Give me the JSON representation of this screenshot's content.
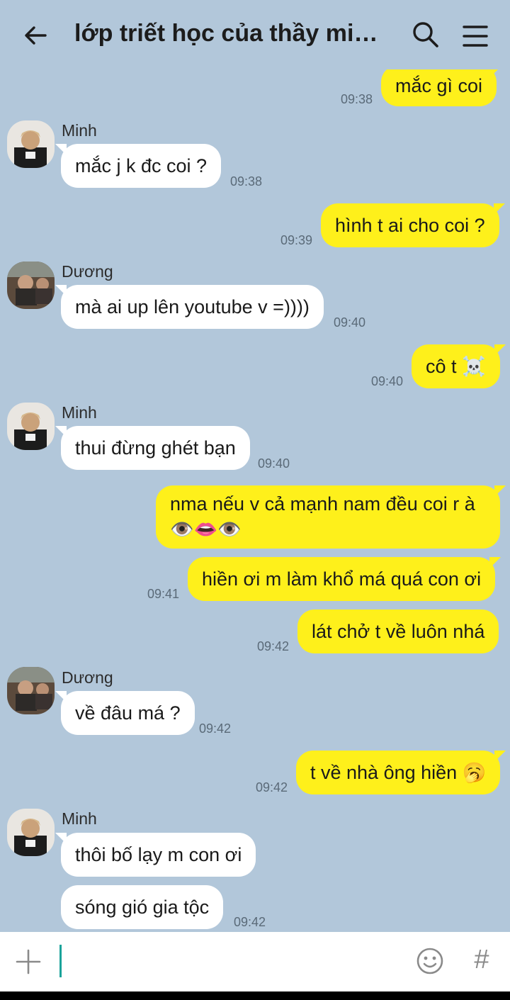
{
  "header": {
    "title": "lớp triết học của thầy min...",
    "icons": [
      "back-arrow-icon",
      "search-icon",
      "menu-icon"
    ]
  },
  "messages": [
    {
      "from": "me",
      "text": "mắc gì coi",
      "time": "09:38"
    },
    {
      "from": "other",
      "sender": "Minh",
      "text": "mắc j k đc coi ?",
      "time": "09:38"
    },
    {
      "from": "me",
      "text": "hình t ai cho coi ?",
      "time": "09:39"
    },
    {
      "from": "other",
      "sender": "Dương",
      "text": "mà ai up lên youtube v =))))",
      "time": "09:40"
    },
    {
      "from": "me",
      "text": "cô t ☠️",
      "time": "09:40"
    },
    {
      "from": "other",
      "sender": "Minh",
      "text": "thui đừng ghét bạn",
      "time": "09:40"
    },
    {
      "from": "me",
      "line1": "nma nếu v cả mạnh nam đều coi r à",
      "line2": "👁️👄👁️"
    },
    {
      "from": "me",
      "text": "hiền ơi m làm khổ má quá con ơi",
      "time": "09:41"
    },
    {
      "from": "me",
      "text": "lát chở t về luôn nhá",
      "time": "09:42"
    },
    {
      "from": "other",
      "sender": "Dương",
      "text": "về đâu má ?",
      "time": "09:42"
    },
    {
      "from": "me",
      "text": "t về nhà ông hiền 🥱",
      "time": "09:42"
    },
    {
      "from": "other",
      "sender": "Minh",
      "text": "thôi bố lạy m con ơi"
    },
    {
      "from": "other",
      "text": "sóng gió gia tộc",
      "time": "09:42"
    }
  ],
  "input": {
    "value": "",
    "icons": [
      "plus-icon",
      "emoji-icon",
      "hash-icon"
    ],
    "hash_label": "#"
  },
  "colors": {
    "background": "#b2c7da",
    "my_bubble": "#fef01b",
    "other_bubble": "#ffffff",
    "cursor": "#1aa39a"
  }
}
